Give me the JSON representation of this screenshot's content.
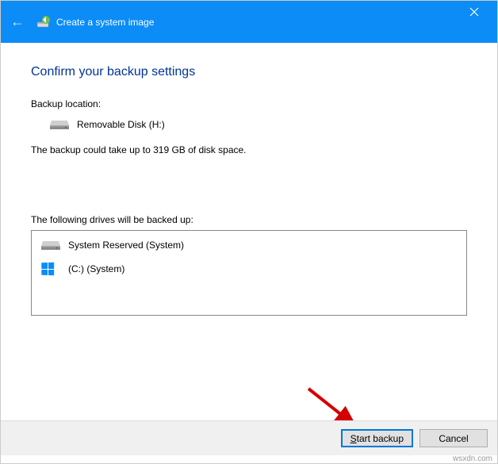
{
  "titlebar": {
    "title": "Create a system image"
  },
  "page": {
    "heading": "Confirm your backup settings",
    "location_label": "Backup location:",
    "location_value": "Removable Disk (H:)",
    "size_note": "The backup could take up to 319 GB of disk space.",
    "drives_label": "The following drives will be backed up:",
    "drives": [
      {
        "name": "System Reserved (System)",
        "icon": "hdd"
      },
      {
        "name": "(C:) (System)",
        "icon": "windows"
      }
    ]
  },
  "buttons": {
    "primary": "Start backup",
    "cancel": "Cancel"
  },
  "watermark": "wsxdn.com"
}
